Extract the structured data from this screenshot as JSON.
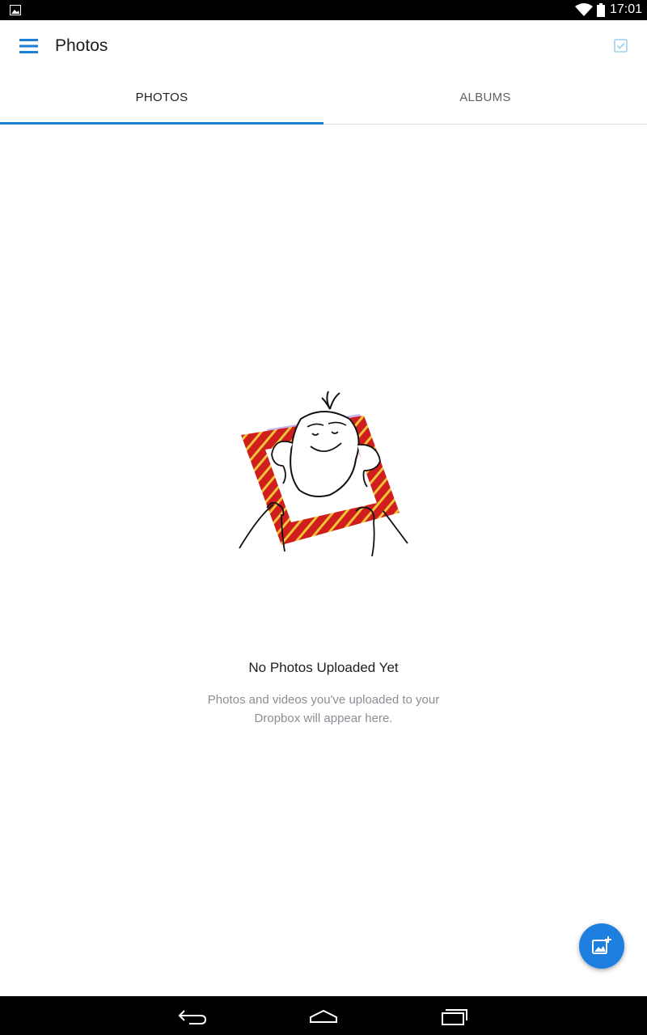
{
  "status_bar": {
    "time": "17:01",
    "icons": [
      "image-notification-icon",
      "wifi-icon",
      "battery-icon"
    ]
  },
  "toolbar": {
    "title": "Photos",
    "menu_icon": "hamburger-menu-icon",
    "select_icon": "checkbox-select-icon"
  },
  "tabs": [
    {
      "label": "PHOTOS",
      "active": true
    },
    {
      "label": "ALBUMS",
      "active": false
    }
  ],
  "empty_state": {
    "title": "No Photos Uploaded Yet",
    "description": "Photos and videos you've uploaded to your Dropbox will appear here."
  },
  "fab": {
    "icon": "add-photo-icon"
  },
  "nav_bar": {
    "icons": [
      "back-icon",
      "home-icon",
      "recents-icon"
    ]
  },
  "colors": {
    "accent": "#1e7fd6",
    "fab": "#1e7fe0",
    "frame_red": "#d01d1d",
    "frame_yellow": "#f2c438",
    "frame_purple": "#c9b0f0"
  }
}
